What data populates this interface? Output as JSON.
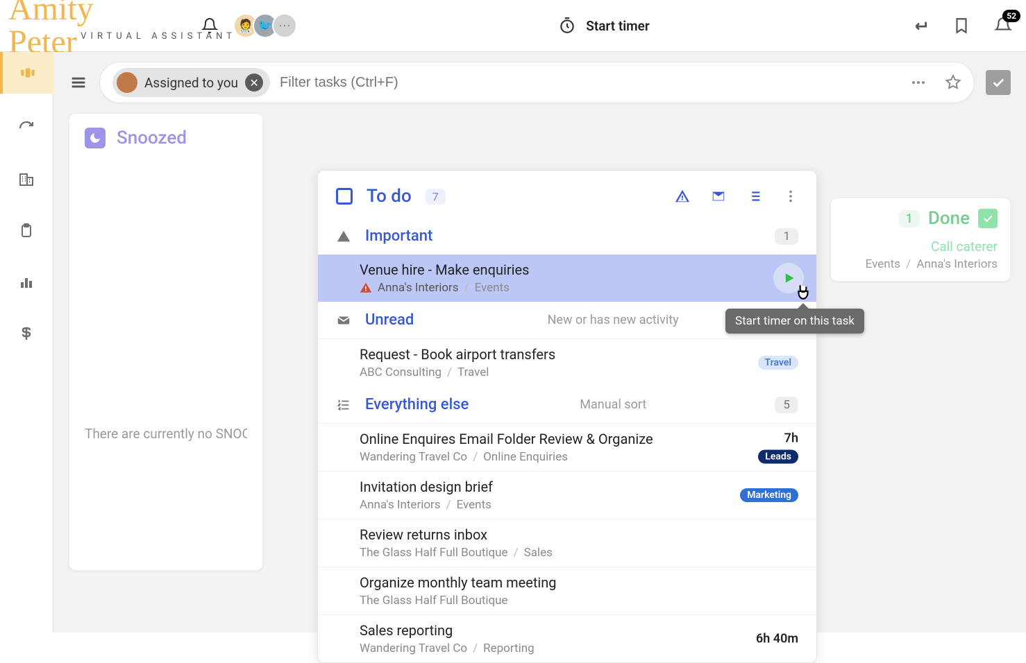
{
  "header": {
    "logo_script": "Amity Peter",
    "logo_sub": "VIRTUAL ASSISTANT",
    "start_timer": "Start timer",
    "notification_count": "52"
  },
  "filter": {
    "chip_label": "Assigned to you",
    "placeholder": "Filter tasks (Ctrl+F)"
  },
  "snoozed": {
    "title": "Snoozed",
    "empty": "There are currently no SNOOZED tasks"
  },
  "done": {
    "title": "Done",
    "count": "1",
    "item_title": "Call caterer",
    "item_client": "Events",
    "item_project": "Anna's Interiors"
  },
  "todo": {
    "title": "To do",
    "count": "7",
    "sections": {
      "important": {
        "title": "Important",
        "count": "1"
      },
      "unread": {
        "title": "Unread",
        "desc": "New or has new activity"
      },
      "else": {
        "title": "Everything else",
        "desc": "Manual sort",
        "count": "5"
      }
    },
    "tasks": {
      "t1": {
        "title": "Venue hire - Make enquiries",
        "client": "Anna's Interiors",
        "project": "Events"
      },
      "t2": {
        "title": "Request - Book airport transfers",
        "client": "ABC Consulting",
        "project": "Travel",
        "tag": "Travel"
      },
      "t3": {
        "title": "Online Enquires Email Folder Review & Organize",
        "client": "Wandering Travel Co",
        "project": "Online Enquiries",
        "time": "7h",
        "tag": "Leads"
      },
      "t4": {
        "title": "Invitation design brief",
        "client": "Anna's Interiors",
        "project": "Events",
        "tag": "Marketing"
      },
      "t5": {
        "title": "Review returns inbox",
        "client": "The Glass Half Full Boutique",
        "project": "Sales"
      },
      "t6": {
        "title": "Organize monthly team meeting",
        "client": "The Glass Half Full Boutique"
      },
      "t7": {
        "title": "Sales reporting",
        "client": "Wandering Travel Co",
        "project": "Reporting",
        "time": "6h 40m"
      }
    }
  },
  "tooltip": "Start timer on this task"
}
